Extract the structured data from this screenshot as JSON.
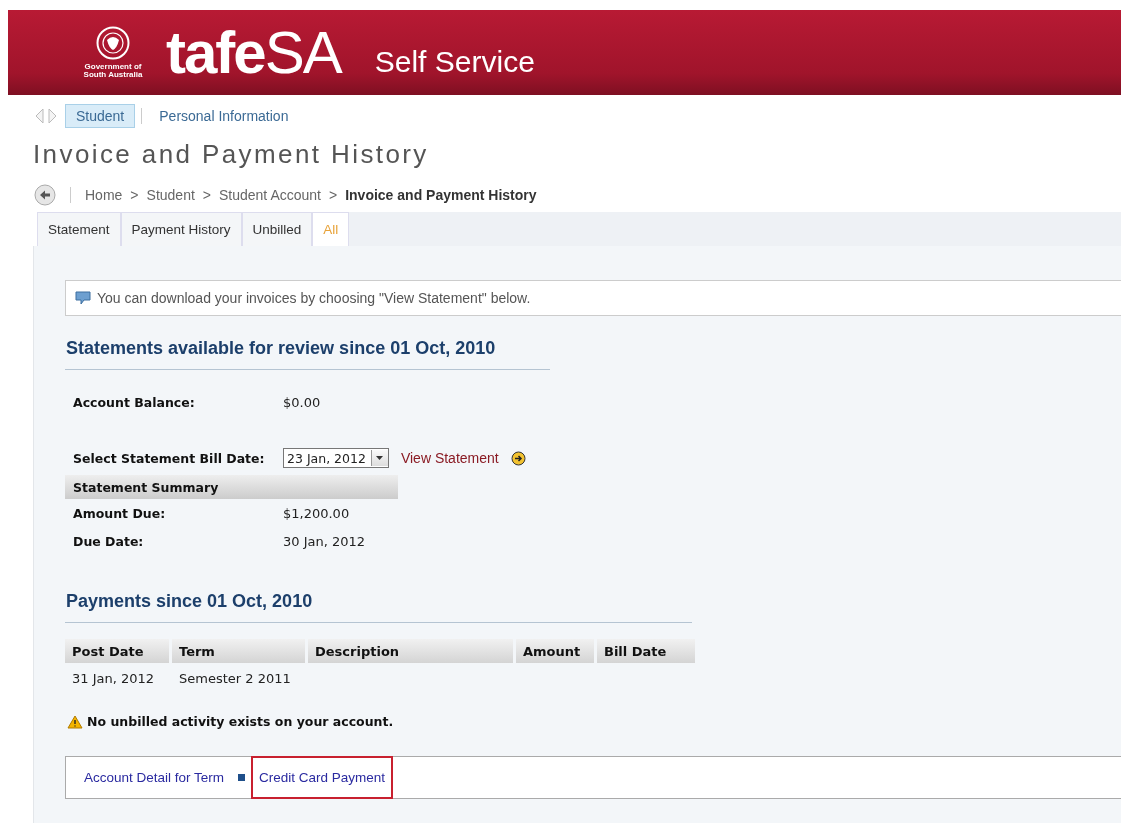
{
  "header": {
    "government": "Government of South Australia",
    "brand": "**tafe**SA",
    "title": "Self Service"
  },
  "nav": [
    {
      "label": "Student",
      "selected": true
    },
    {
      "label": "Personal Information",
      "selected": false
    }
  ],
  "page_title": "Invoice and Payment History",
  "breadcrumb": [
    {
      "label": "Home",
      "current": false
    },
    {
      "separator": ">",
      "label": "Student",
      "current": false
    },
    {
      "separator": ">",
      "label": "Student Account",
      "current": false
    },
    {
      "separator": ">",
      "label": "Invoice and Payment History",
      "current": true
    }
  ],
  "tabs": [
    {
      "label": "Statement",
      "selected": false
    },
    {
      "label": "Payment History",
      "selected": false
    },
    {
      "label": "Unbilled",
      "selected": false
    },
    {
      "label": "All",
      "selected": true
    }
  ],
  "info": "You can download your invoices by choosing \"View Statement\" below.",
  "statements": {
    "heading": "Statements available for review since 01 Oct, 2010",
    "balance_label": "Account Balance:",
    "balance": "$0.00",
    "select_label": "Select Statement Bill Date:",
    "select_value": "23 Jan, 2012",
    "view_link": "View Statement",
    "summary_heading": "Statement Summary",
    "summary": [
      {
        "label": "Amount Due:",
        "value": "$1,200.00"
      },
      {
        "label": "Due Date:",
        "value": "30 Jan, 2012"
      }
    ]
  },
  "payments": {
    "heading": "Payments since 01 Oct, 2010",
    "columns": [
      "Post Date",
      "Term",
      "Description",
      "Amount",
      "Bill Date"
    ],
    "rows": [
      [
        "31 Jan, 2012",
        "Semester 2 2011",
        "",
        "",
        ""
      ]
    ]
  },
  "warning": "No unbilled activity exists on your account.",
  "links": [
    {
      "label": "Account Detail for Term",
      "highlighted": false
    },
    {
      "label": "Credit Card Payment",
      "highlighted": true
    }
  ]
}
